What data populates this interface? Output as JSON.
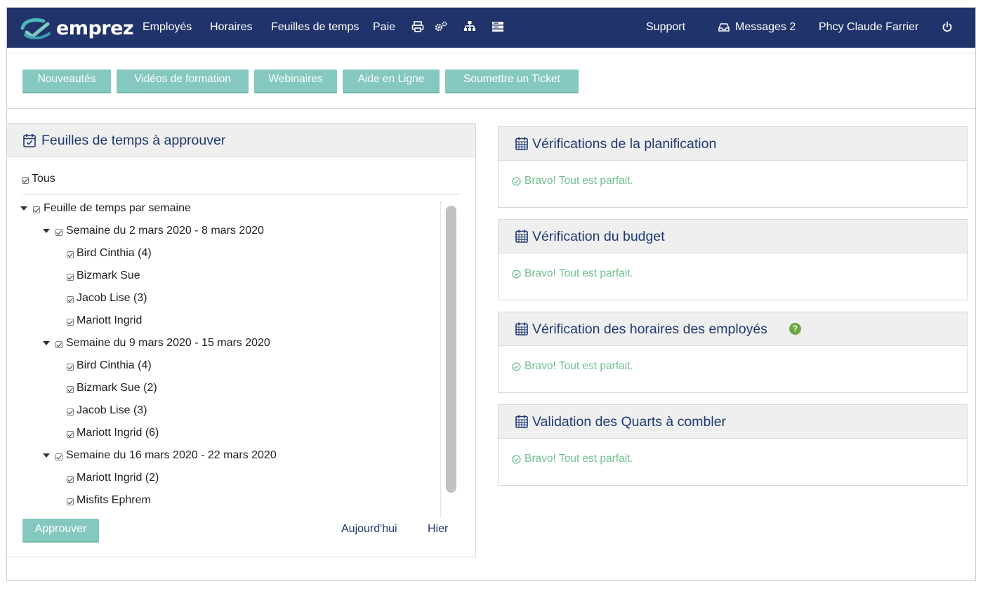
{
  "app": {
    "logo_text": "emprez",
    "brand_color": "#21336b",
    "accent_color": "#84c8bf",
    "success_color": "#6fc08f"
  },
  "navbar": {
    "items": [
      "Employés",
      "Horaires",
      "Feuilles de temps",
      "Paie"
    ],
    "icons": [
      "printer-icon",
      "gears-icon",
      "org-chart-icon",
      "server-icon"
    ],
    "support": "Support",
    "messages": "Messages 2",
    "user": "Phcy Claude Farrier",
    "power_icon": "power-icon"
  },
  "toolbar": {
    "buttons": [
      "Nouveautés",
      "Vidéos de formation",
      "Webinaires",
      "Aide en Ligne",
      "Soumettre un Ticket"
    ]
  },
  "timesheets": {
    "title": "Feuilles de temps à approuver",
    "all_label": "Tous",
    "root_label": "Feuille de temps par semaine",
    "weeks": [
      {
        "label": "Semaine du 2 mars 2020 - 8 mars 2020",
        "employees": [
          "Bird Cinthia (4)",
          "Bizmark Sue",
          "Jacob Lise (3)",
          "Mariott Ingrid"
        ]
      },
      {
        "label": "Semaine du 9 mars 2020 - 15 mars 2020",
        "employees": [
          "Bird Cinthia (4)",
          "Bizmark Sue (2)",
          "Jacob Lise (3)",
          "Mariott Ingrid (6)"
        ]
      },
      {
        "label": "Semaine du 16 mars 2020 - 22 mars 2020",
        "employees": [
          "Mariott Ingrid (2)",
          "Misfits Ephrem"
        ]
      }
    ],
    "approve_label": "Approuver",
    "today_label": "Aujourd'hui",
    "yesterday_label": "Hier"
  },
  "checks": [
    {
      "title": "Vérifications de la planification",
      "status": "Bravo! Tout est parfait."
    },
    {
      "title": "Vérification du budget",
      "status": "Bravo! Tout est parfait."
    },
    {
      "title": "Vérification des horaires des employés",
      "status": "Bravo! Tout est parfait.",
      "help_icon": "?"
    },
    {
      "title": "Validation des Quarts à combler",
      "status": "Bravo! Tout est parfait."
    }
  ]
}
